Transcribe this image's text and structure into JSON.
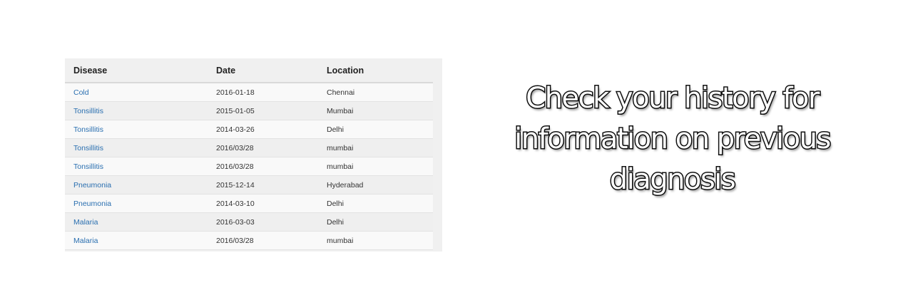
{
  "table": {
    "headers": {
      "disease": "Disease",
      "date": "Date",
      "location": "Location"
    },
    "rows": [
      {
        "disease": "Cold",
        "date": "2016-01-18",
        "location": "Chennai"
      },
      {
        "disease": "Tonsillitis",
        "date": "2015-01-05",
        "location": "Mumbai"
      },
      {
        "disease": "Tonsillitis",
        "date": "2014-03-26",
        "location": "Delhi"
      },
      {
        "disease": "Tonsillitis",
        "date": "2016/03/28",
        "location": "mumbai"
      },
      {
        "disease": "Tonsillitis",
        "date": "2016/03/28",
        "location": "mumbai"
      },
      {
        "disease": "Pneumonia",
        "date": "2015-12-14",
        "location": "Hyderabad"
      },
      {
        "disease": "Pneumonia",
        "date": "2014-03-10",
        "location": "Delhi"
      },
      {
        "disease": "Malaria",
        "date": "2016-03-03",
        "location": "Delhi"
      },
      {
        "disease": "Malaria",
        "date": "2016/03/28",
        "location": "mumbai"
      }
    ]
  },
  "caption": "Check your history for information on previous diagnosis",
  "colors": {
    "link": "#2a6fb0",
    "panel_background": "#f0f0f0",
    "caption_fill": "#ffffff",
    "caption_outline": "#111111"
  }
}
